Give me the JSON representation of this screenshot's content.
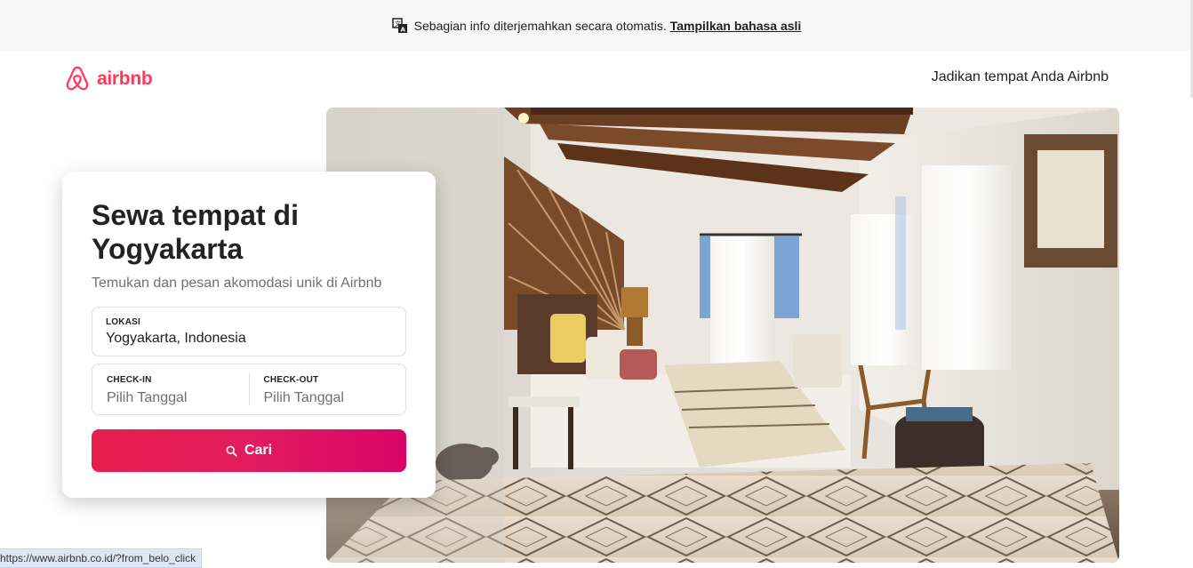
{
  "translation_bar": {
    "message": "Sebagian info diterjemahkan secara otomatis.",
    "link": "Tampilkan bahasa asli"
  },
  "header": {
    "brand": "airbnb",
    "host_link": "Jadikan tempat Anda Airbnb"
  },
  "search_card": {
    "title": "Sewa tempat di Yogyakarta",
    "subtitle": "Temukan dan pesan akomodasi unik di Airbnb",
    "location_label": "LOKASI",
    "location_value": "Yogyakarta, Indonesia",
    "checkin_label": "CHECK-IN",
    "checkin_placeholder": "Pilih Tanggal",
    "checkout_label": "CHECK-OUT",
    "checkout_placeholder": "Pilih Tanggal",
    "search_button": "Cari"
  },
  "status_bar": {
    "url": "https://www.airbnb.co.id/?from_belo_click"
  },
  "colors": {
    "brand": "#ff385c",
    "button_start": "#e61e4d",
    "button_end": "#d70466",
    "muted_text": "#717171"
  },
  "icons": [
    "translate-icon",
    "airbnb-logo-icon",
    "search-icon"
  ]
}
